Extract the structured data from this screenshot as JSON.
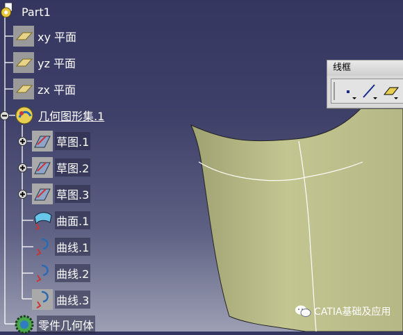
{
  "tree": {
    "root": "Part1",
    "planes": [
      "xy 平面",
      "yz 平面",
      "zx 平面"
    ],
    "geo_set": "几何图形集.1",
    "sketches": [
      "草图.1",
      "草图.2",
      "草图.3"
    ],
    "surface": "曲面.1",
    "curves": [
      "曲线.1",
      "曲线.2",
      "曲线.3"
    ],
    "part_body": "零件几何体"
  },
  "toolbar": {
    "title": "线框",
    "tools": [
      "point-icon",
      "line-icon",
      "plane-icon"
    ]
  },
  "watermark": {
    "text": "CATIA基础及应用"
  },
  "colors": {
    "background_top": "#35365f",
    "background_bottom": "#9d9fb4",
    "surface_fill": "#b9bc86"
  }
}
